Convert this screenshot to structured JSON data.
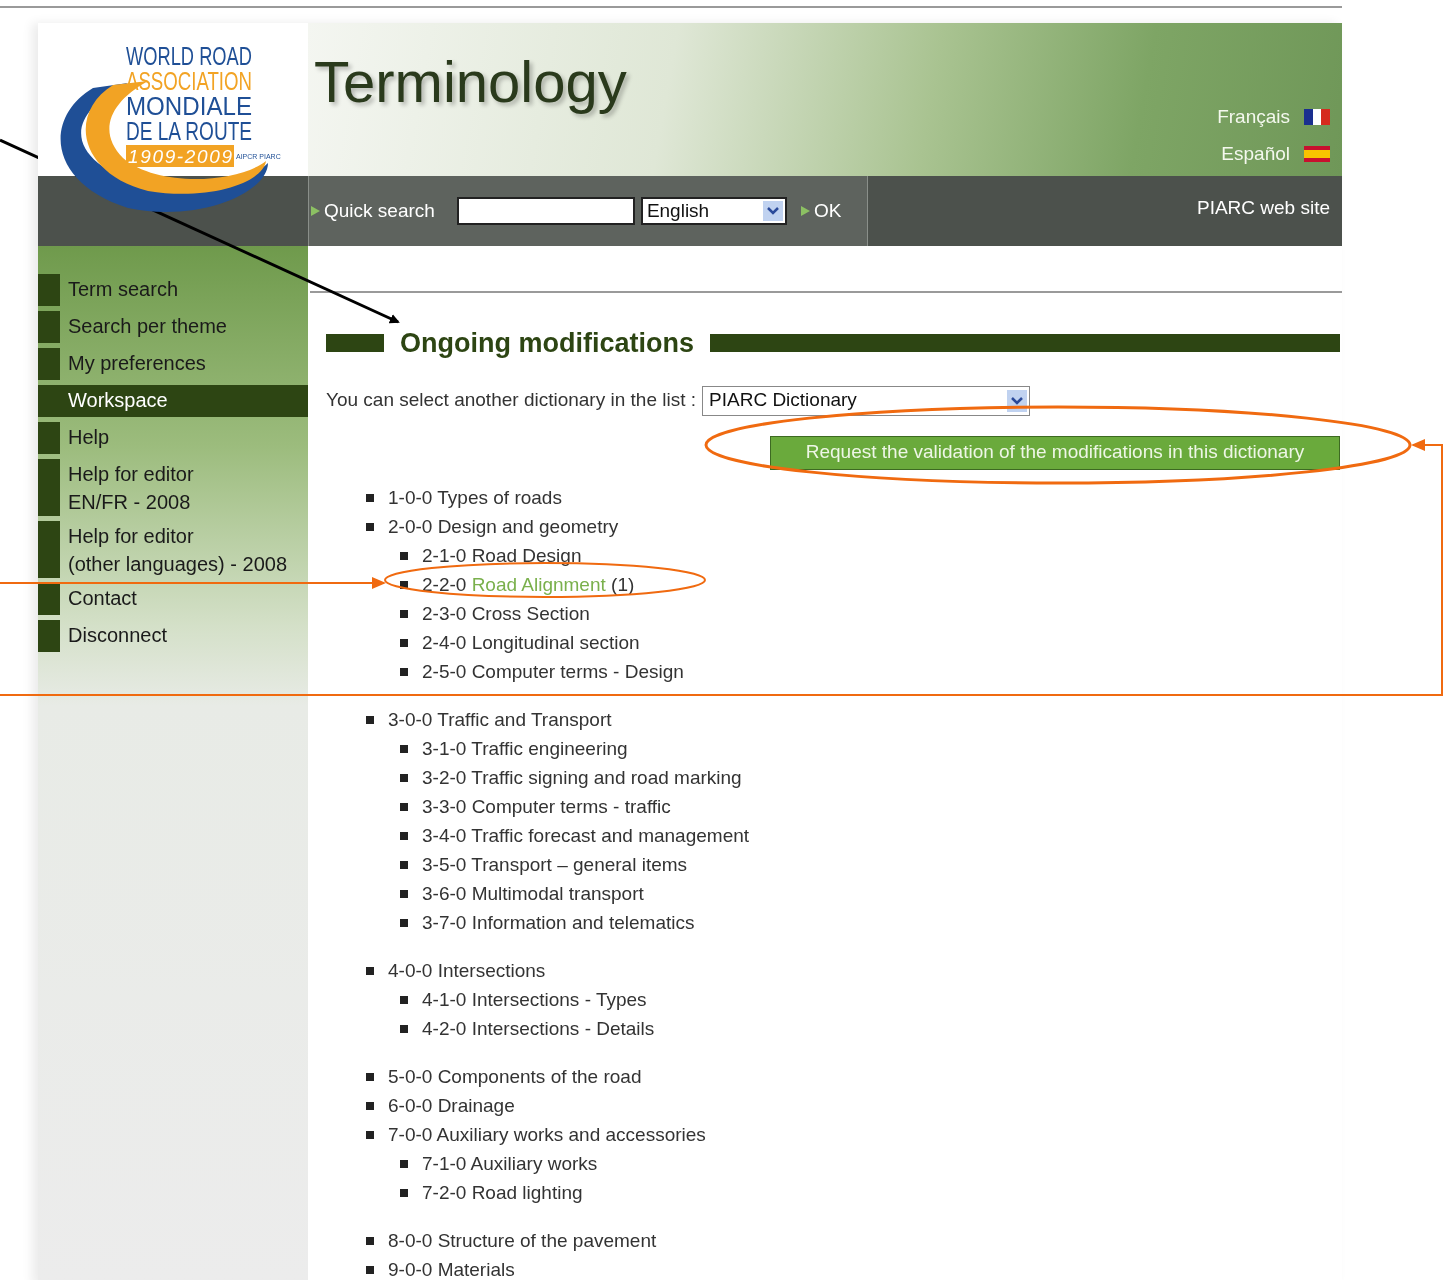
{
  "logo": {
    "lines": [
      "WORLD ROAD",
      "ASSOCIATION",
      "MONDIALE",
      "DE LA ROUTE"
    ],
    "years": "1909-2009",
    "tags": [
      "AIPCR",
      "PIARC"
    ]
  },
  "banner": {
    "title": "Terminology",
    "languages": [
      {
        "label": "Français",
        "kind": "fr"
      },
      {
        "label": "Español",
        "kind": "es"
      }
    ]
  },
  "quick_search": {
    "label": "Quick search",
    "language": "English",
    "ok": "OK",
    "site_link": "PIARC web site"
  },
  "sidebar": {
    "items": [
      {
        "label": "Term search",
        "selected": false
      },
      {
        "label": "Search per theme",
        "selected": false
      },
      {
        "label": "My preferences",
        "selected": false
      },
      {
        "label": "Workspace",
        "selected": true
      },
      {
        "label": "Help",
        "selected": false
      },
      {
        "label": "Help for editor\nEN/FR - 2008",
        "selected": false
      },
      {
        "label": "Help for editor\n(other languages) - 2008",
        "selected": false
      },
      {
        "label": "Contact",
        "selected": false
      },
      {
        "label": "Disconnect",
        "selected": false
      }
    ]
  },
  "content": {
    "heading": "Ongoing modifications",
    "dictionary_label": "You can select another dictionary in the list :",
    "dictionary": "PIARC Dictionary",
    "request_button": "Request the validation of the modifications in this dictionary",
    "theme_groups": [
      [
        {
          "kind": "plain",
          "text": "1-0-0 Types of roads"
        },
        {
          "kind": "plain",
          "text": "2-0-0 Design and geometry",
          "children": [
            {
              "kind": "plain",
              "text": "2-1-0 Road Design"
            },
            {
              "kind": "link",
              "code": "2-2-0",
              "link": "Road Alignment",
              "count": "(1)"
            },
            {
              "kind": "plain",
              "text": "2-3-0 Cross Section"
            },
            {
              "kind": "plain",
              "text": "2-4-0 Longitudinal section"
            },
            {
              "kind": "plain",
              "text": "2-5-0 Computer terms - Design"
            }
          ]
        }
      ],
      [
        {
          "kind": "plain",
          "text": "3-0-0 Traffic and Transport",
          "children": [
            {
              "kind": "plain",
              "text": "3-1-0 Traffic engineering"
            },
            {
              "kind": "plain",
              "text": "3-2-0 Traffic signing and road marking"
            },
            {
              "kind": "plain",
              "text": "3-3-0 Computer terms - traffic"
            },
            {
              "kind": "plain",
              "text": "3-4-0 Traffic forecast and management"
            },
            {
              "kind": "plain",
              "text": "3-5-0 Transport – general items"
            },
            {
              "kind": "plain",
              "text": "3-6-0 Multimodal transport"
            },
            {
              "kind": "plain",
              "text": "3-7-0 Information and telematics"
            }
          ]
        }
      ],
      [
        {
          "kind": "plain",
          "text": "4-0-0 Intersections",
          "children": [
            {
              "kind": "plain",
              "text": "4-1-0 Intersections - Types"
            },
            {
              "kind": "plain",
              "text": "4-2-0 Intersections - Details"
            }
          ]
        }
      ],
      [
        {
          "kind": "plain",
          "text": "5-0-0 Components of the road"
        },
        {
          "kind": "plain",
          "text": "6-0-0 Drainage"
        },
        {
          "kind": "plain",
          "text": "7-0-0 Auxiliary works and accessories",
          "children": [
            {
              "kind": "plain",
              "text": "7-1-0 Auxiliary works"
            },
            {
              "kind": "plain",
              "text": "7-2-0 Road lighting"
            }
          ]
        }
      ],
      [
        {
          "kind": "plain",
          "text": "8-0-0 Structure of the pavement"
        },
        {
          "kind": "plain",
          "text": "9-0-0 Materials"
        }
      ]
    ]
  }
}
